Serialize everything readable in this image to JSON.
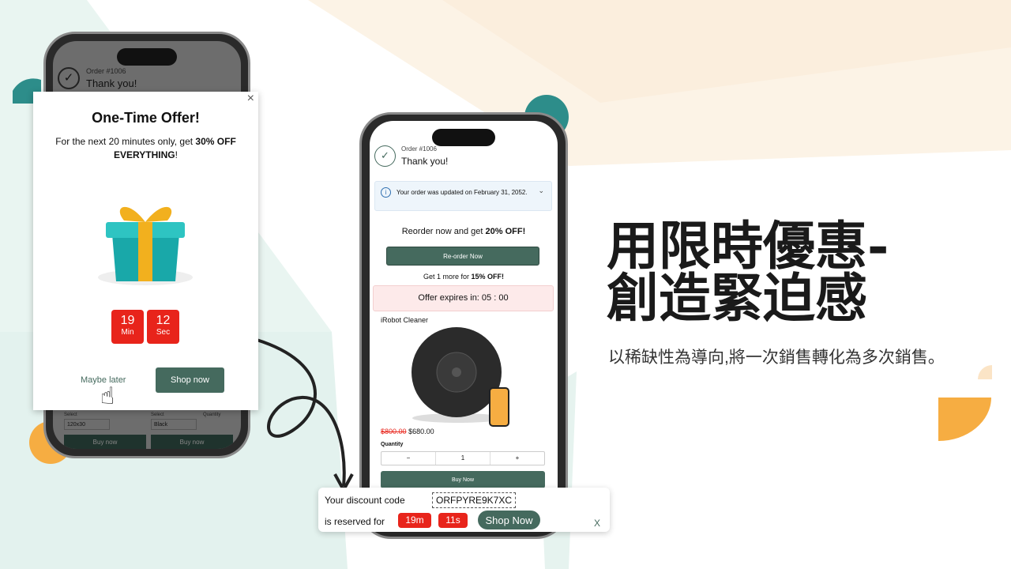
{
  "left_phone": {
    "order_number": "Order #1006",
    "thank_you": "Thank you!",
    "popup": {
      "title": "One-Time Offer!",
      "text_pre": "For the next 20 minutes only, get ",
      "text_bold": "30% OFF EVERYTHING",
      "text_post": "!",
      "timer": [
        {
          "value": "19",
          "unit": "Min"
        },
        {
          "value": "12",
          "unit": "Sec"
        }
      ],
      "maybe_later": "Maybe later",
      "shop_now": "Shop now",
      "close": "×"
    },
    "bg_product": {
      "select_label": "Select",
      "quantity_label": "Quantity",
      "size_value": "120x30",
      "color_value": "Black",
      "qty": "1",
      "minus": "−",
      "plus": "+",
      "buy_now": "Buy now"
    }
  },
  "center_phone": {
    "order_number": "Order #1006",
    "thank_you": "Thank you!",
    "notice": "Your order was updated on February 31, 2052.",
    "reorder_pre": "Reorder now and get ",
    "reorder_bold": "20% OFF!",
    "reorder_button": "Re-order Now",
    "more_pre": "Get 1 more for ",
    "more_bold": "15% OFF!",
    "expires": "Offer expires in: 05 : 00",
    "product_name": "iRobot Cleaner",
    "old_price": "$800.00",
    "new_price": "$680.00",
    "quantity_label": "Quantity",
    "qty": "1",
    "minus": "−",
    "plus": "+",
    "buy_now": "Buy Now"
  },
  "discount_bar": {
    "code_label": "Your discount code",
    "code": "ORFPYRE9K7XC",
    "reserved_label": "is reserved for",
    "minutes": "19m",
    "seconds": "11s",
    "shop_now": "Shop Now",
    "close": "X"
  },
  "headline": {
    "line1": "用限時優惠-",
    "line2": "創造緊迫感",
    "subtitle": "以稀缺性為導向,將一次銷售轉化為多次銷售。"
  },
  "colors": {
    "accent_green": "#456a5e",
    "timer_red": "#e8241b",
    "orange": "#f6ad42",
    "teal": "#2d8d8a",
    "beige": "#fbf1e2"
  }
}
